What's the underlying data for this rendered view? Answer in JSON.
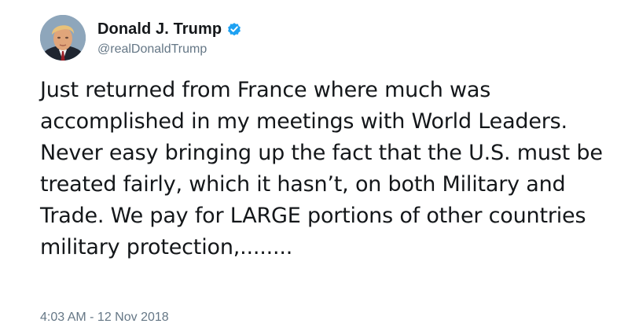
{
  "author": {
    "display_name": "Donald J. Trump",
    "handle": "@realDonaldTrump",
    "verified": true,
    "verified_color": "#1da1f2"
  },
  "tweet": {
    "text": "Just returned from France where much was accomplished in my meetings with World Leaders. Never easy bringing up the fact that the U.S. must be treated fairly, which it hasn’t, on both Military and Trade. We pay for LARGE portions of other countries military protection,........",
    "timestamp": "4:03 AM - 12 Nov 2018"
  },
  "icons": {
    "verified": "verified-badge-icon",
    "avatar": "profile-photo"
  },
  "colors": {
    "text": "#14171a",
    "secondary": "#657786",
    "background": "#ffffff"
  }
}
